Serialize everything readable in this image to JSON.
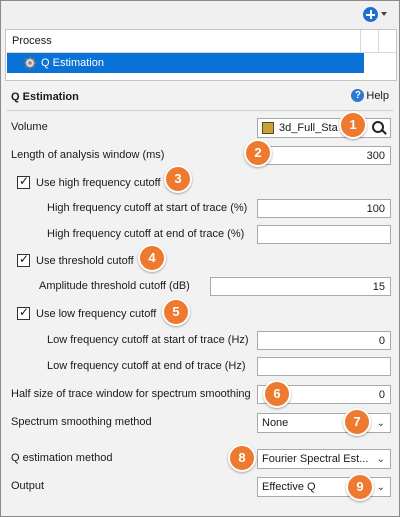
{
  "process_panel": {
    "header": "Process",
    "item": "Q Estimation"
  },
  "main": {
    "title": "Q Estimation",
    "help": "Help",
    "volume": {
      "label": "Volume",
      "value": "3d_Full_Sta"
    },
    "analysis_window": {
      "label": "Length of analysis window (ms)",
      "value": "300"
    },
    "high_cutoff": {
      "checkbox_label": "Use high frequency cutoff",
      "start_label": "High frequency cutoff at start of trace (%)",
      "start_value": "100",
      "end_label": "High frequency cutoff at end of trace (%)",
      "end_value": ""
    },
    "threshold_cutoff": {
      "checkbox_label": "Use threshold cutoff",
      "amp_label": "Amplitude threshold cutoff (dB)",
      "amp_value": "15"
    },
    "low_cutoff": {
      "checkbox_label": "Use low frequency cutoff",
      "start_label": "Low frequency cutoff at start of trace (Hz)",
      "start_value": "0",
      "end_label": "Low frequency cutoff at end of trace (Hz)",
      "end_value": ""
    },
    "half_size": {
      "label": "Half size of trace window for spectrum smoothing",
      "value": "0"
    },
    "smoothing": {
      "label": "Spectrum smoothing method",
      "value": "None"
    },
    "q_method": {
      "label": "Q estimation method",
      "value": "Fourier Spectral Est..."
    },
    "output": {
      "label": "Output",
      "value": "Effective Q"
    }
  },
  "badges": [
    "1",
    "2",
    "3",
    "4",
    "5",
    "6",
    "7",
    "8",
    "9"
  ],
  "icons": {
    "add": "add-circle-icon",
    "help": "help-icon",
    "gear": "gear-icon",
    "search": "search-icon",
    "volume": "volume-cube-icon",
    "dropdown": "chevron-down-icon"
  },
  "colors": {
    "accent": "#0a72d6",
    "badge": "#ee7a2f"
  }
}
